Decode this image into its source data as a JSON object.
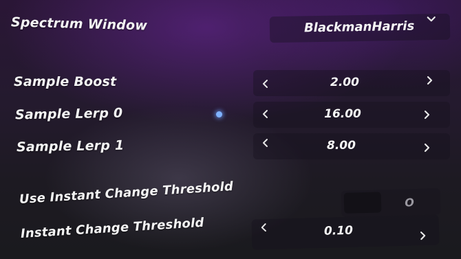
{
  "settings": [
    {
      "label": "Spectrum Window",
      "value": "BlackmanHarris",
      "control": "dropdown"
    },
    {
      "label": "Sample Boost",
      "value": "2.00",
      "control": "stepper"
    },
    {
      "label": "Sample Lerp 0",
      "value": "16.00",
      "control": "stepper"
    },
    {
      "label": "Sample Lerp 1",
      "value": "8.00",
      "control": "stepper"
    },
    {
      "label": "Use Instant Change Threshold",
      "value": "O",
      "control": "toggle"
    },
    {
      "label": "Instant Change Threshold",
      "value": "0.10",
      "control": "stepper"
    }
  ],
  "icons": {
    "dropdown": "chevron-down-icon",
    "decrement": "chevron-left-icon",
    "increment": "chevron-right-icon",
    "pointer": "pointer-dot"
  },
  "colors": {
    "accent_pointer": "#7fb2ff",
    "text": "#f4f4f4"
  }
}
